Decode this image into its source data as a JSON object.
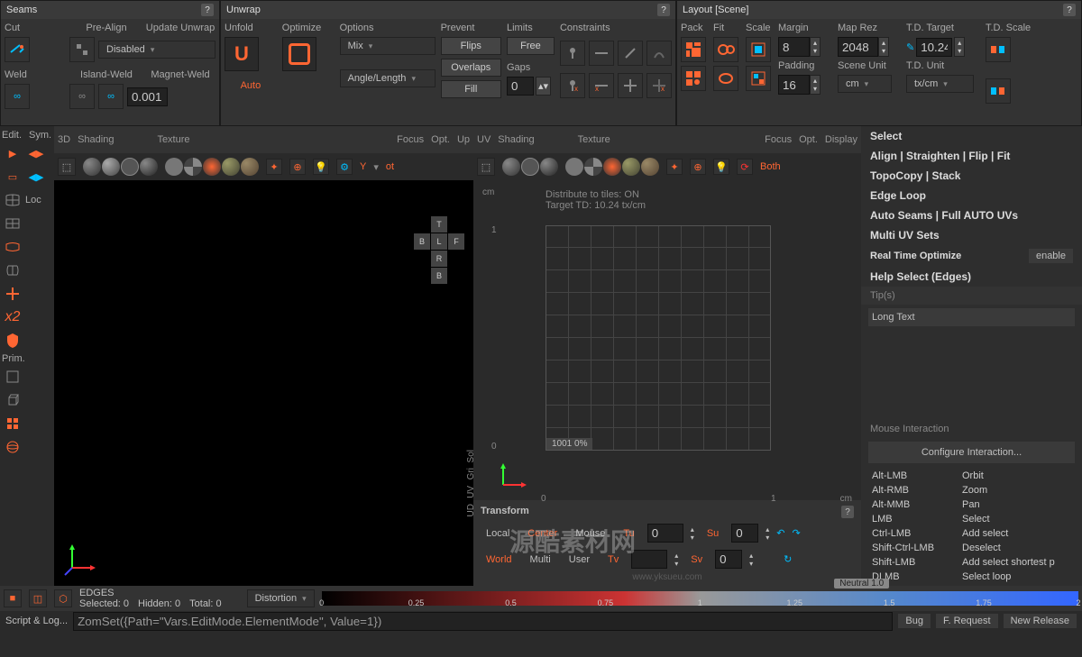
{
  "panels": {
    "seams": {
      "title": "Seams",
      "cut": "Cut",
      "prealign": "Pre-Align",
      "update_unwrap": "Update Unwrap",
      "disabled": "Disabled",
      "weld": "Weld",
      "island_weld": "Island-Weld",
      "magnet_weld": "Magnet-Weld",
      "magnet_value": "0.001"
    },
    "unwrap": {
      "title": "Unwrap",
      "unfold": "Unfold",
      "optimize": "Optimize",
      "options": "Options",
      "mix": "Mix",
      "angle_length": "Angle/Length",
      "auto": "Auto",
      "prevent": "Prevent",
      "flips": "Flips",
      "overlaps": "Overlaps",
      "fill": "Fill",
      "limits": "Limits",
      "free": "Free",
      "gaps": "Gaps",
      "gaps_value": "0",
      "constraints": "Constraints"
    },
    "layout": {
      "title": "Layout [Scene]",
      "pack": "Pack",
      "fit": "Fit",
      "scale": "Scale",
      "margin": "Margin",
      "margin_value": "8",
      "padding": "Padding",
      "padding_value": "16",
      "map_rez": "Map Rez",
      "map_rez_value": "2048",
      "scene_unit": "Scene Unit",
      "scene_unit_value": "cm",
      "td_target": "T.D. Target",
      "td_target_value": "10.24",
      "td_unit": "T.D. Unit",
      "td_unit_value": "tx/cm",
      "td_scale": "T.D. Scale"
    }
  },
  "left_sidebar": {
    "edit": "Edit.",
    "sym": "Sym.",
    "loc": "Loc",
    "x2": "x2",
    "prim": "Prim."
  },
  "viewport3d": {
    "tabs": {
      "d3": "3D",
      "shading": "Shading",
      "texture": "Texture",
      "focus": "Focus",
      "opt": "Opt.",
      "up": "Up"
    },
    "axis_y": "Y",
    "ot": "ot",
    "nav": {
      "t": "T",
      "b": "B",
      "l": "L",
      "f": "F",
      "r": "R",
      "b2": "B"
    }
  },
  "viewportuv": {
    "tabs": {
      "uv": "UV",
      "shading": "Shading",
      "texture": "Texture",
      "focus": "Focus",
      "opt": "Opt.",
      "display": "Display"
    },
    "both": "Both",
    "unit": "cm",
    "distribute": "Distribute to tiles: ON",
    "target_td": "Target TD: 10.24 tx/cm",
    "tick0": "0",
    "tick1": "1",
    "readout": "1001   0%",
    "vert": {
      "sol": "Sol",
      "gri": "Gri",
      "uv": "UV",
      "ud": "UD"
    }
  },
  "right_menu": {
    "items": [
      "Select",
      "Align | Straighten | Flip | Fit",
      "TopoCopy | Stack",
      "Edge Loop",
      "Auto Seams | Full AUTO UVs",
      "Multi UV Sets",
      "Real Time Optimize",
      "Help Select (Edges)"
    ],
    "enable": "enable",
    "tips_label": "Tip(s)",
    "tips_text": "Long Text",
    "mouse_label": "Mouse Interaction",
    "configure": "Configure Interaction...",
    "mouse_rows": [
      {
        "key": "Alt-LMB",
        "action": "Orbit"
      },
      {
        "key": "Alt-RMB",
        "action": "Zoom"
      },
      {
        "key": "Alt-MMB",
        "action": "Pan"
      },
      {
        "key": "LMB",
        "action": "Select"
      },
      {
        "key": "Ctrl-LMB",
        "action": "Add select"
      },
      {
        "key": "Shift-Ctrl-LMB",
        "action": "Deselect"
      },
      {
        "key": "Shift-LMB",
        "action": "Add select shortest p"
      },
      {
        "key": "DLMB",
        "action": "Select loop"
      }
    ]
  },
  "transform": {
    "title": "Transform",
    "local": "Local",
    "world": "World",
    "center": "Center",
    "multi": "Multi",
    "mouse": "Mouse",
    "user": "User",
    "tu": "Tu",
    "tv": "Tv",
    "tu_val": "0",
    "tv_val": "",
    "su": "Su",
    "sv": "Sv",
    "su_val": "0",
    "sv_val": "0",
    "watermark": "www.yksueu.com"
  },
  "status": {
    "mode": "EDGES",
    "selected": "Selected: 0",
    "hidden": "Hidden: 0",
    "total": "Total: 0",
    "distortion": "Distortion",
    "neutral": "Neutral 1.0",
    "ticks": [
      "0",
      "0.25",
      "0.5",
      "0.75",
      "1",
      "1.25",
      "1.5",
      "1.75",
      "2"
    ]
  },
  "script": {
    "label": "Script & Log...",
    "command": "ZomSet({Path=\"Vars.EditMode.ElementMode\", Value=1})",
    "bug": "Bug",
    "frequest": "F. Request",
    "newrelease": "New Release"
  },
  "watermark_cn": "源酷素材网"
}
